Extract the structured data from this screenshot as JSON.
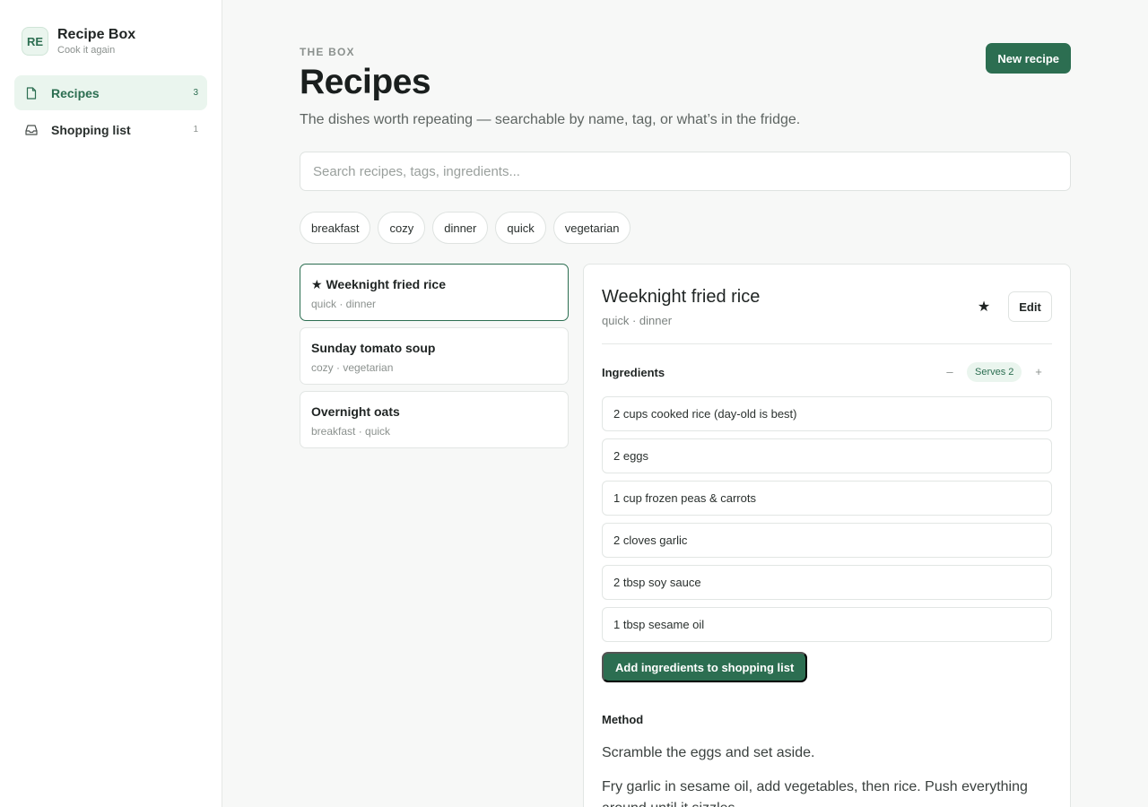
{
  "brand": {
    "badge": "RE",
    "title": "Recipe Box",
    "subtitle": "Cook it again"
  },
  "nav": [
    {
      "label": "Recipes",
      "count": "3",
      "icon": "document-icon",
      "active": true
    },
    {
      "label": "Shopping list",
      "count": "1",
      "icon": "inbox-icon",
      "active": false
    }
  ],
  "header": {
    "eyebrow": "THE BOX",
    "title": "Recipes",
    "description": "The dishes worth repeating — searchable by name, tag, or what’s in the fridge.",
    "new_button": "New recipe"
  },
  "search": {
    "placeholder": "Search recipes, tags, ingredients..."
  },
  "tags": [
    "breakfast",
    "cozy",
    "dinner",
    "quick",
    "vegetarian"
  ],
  "recipes": [
    {
      "title": "★ Weeknight fried rice",
      "tags": "quick · dinner",
      "active": true
    },
    {
      "title": "Sunday tomato soup",
      "tags": "cozy · vegetarian",
      "active": false
    },
    {
      "title": "Overnight oats",
      "tags": "breakfast · quick",
      "active": false
    }
  ],
  "detail": {
    "title": "Weeknight fried rice",
    "tags": "quick · dinner",
    "star": "★",
    "edit_label": "Edit",
    "ingredients_heading": "Ingredients",
    "minus": "–",
    "serves": "Serves 2",
    "plus": "+",
    "ingredients": [
      "2 cups cooked rice (day-old is best)",
      "2 eggs",
      "1 cup frozen peas & carrots",
      "2 cloves garlic",
      "2 tbsp soy sauce",
      "1 tbsp sesame oil"
    ],
    "add_button": "Add ingredients to shopping list",
    "method_heading": "Method",
    "method": [
      "Scramble the eggs and set aside.",
      "Fry garlic in sesame oil, add vegetables, then rice. Push everything around until it sizzles."
    ]
  },
  "colors": {
    "accent": "#2c6e51",
    "accent_soft": "#eaf5ee"
  }
}
